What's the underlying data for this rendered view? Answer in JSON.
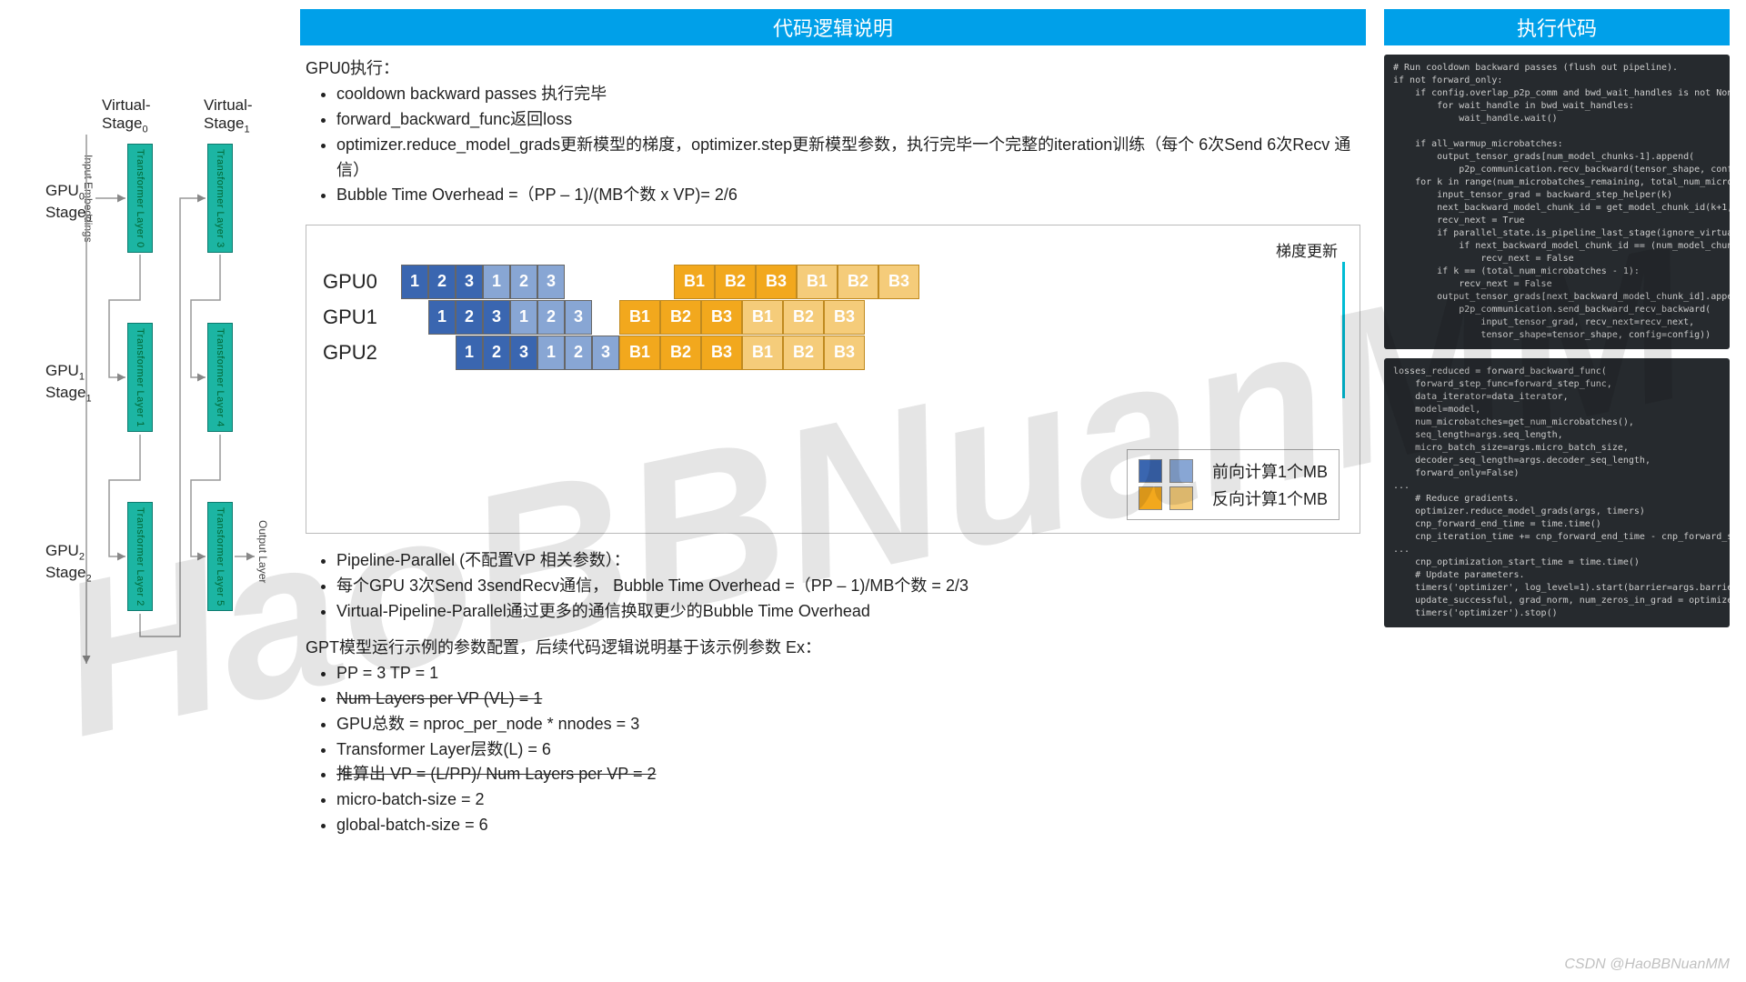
{
  "watermark": "HaoBBNuanMM",
  "footer": "CSDN @HaoBBNuanMM",
  "headers": {
    "mid": "代码逻辑说明",
    "right": "执行代码"
  },
  "left_diagram": {
    "vs0": "Virtual-Stage",
    "vs0_sub": "0",
    "vs1": "Virtual-Stage",
    "vs1_sub": "1",
    "gpu0_a": "GPU",
    "gpu0_as": "0",
    "gpu0_b": "Stage",
    "gpu0_bs": "0",
    "gpu1_a": "GPU",
    "gpu1_as": "1",
    "gpu1_b": "Stage",
    "gpu1_bs": "1",
    "gpu2_a": "GPU",
    "gpu2_as": "2",
    "gpu2_b": "Stage",
    "gpu2_bs": "2",
    "tl0": "Transformer Layer 0",
    "tl1": "Transformer Layer 1",
    "tl2": "Transformer Layer 2",
    "tl3": "Transformer Layer 3",
    "tl4": "Transformer Layer 4",
    "tl5": "Transformer Layer 5",
    "inp": "Input Embeddings",
    "out": "Output Layer"
  },
  "section1": {
    "title": "GPU0执行：",
    "b1": "cooldown backward passes 执行完毕",
    "b2": "forward_backward_func返回loss",
    "b3": "optimizer.reduce_model_grads更新模型的梯度，optimizer.step更新模型参数，执行完毕一个完整的iteration训练（每个 6次Send 6次Recv 通信）",
    "b4": "Bubble Time Overhead =（PP – 1)/(MB个数 x VP)= 2/6"
  },
  "sched": {
    "grad": "梯度更新",
    "gpu0": "GPU0",
    "gpu1": "GPU1",
    "gpu2": "GPU2",
    "n1": "1",
    "n2": "2",
    "n3": "3",
    "B1": "B1",
    "B2": "B2",
    "B3": "B3",
    "leg_fwd": "前向计算1个MB",
    "leg_bwd": "反向计算1个MB"
  },
  "section2": {
    "b1": "Pipeline-Parallel (不配置VP 相关参数）：",
    "b2": "每个GPU 3次Send 3sendRecv通信， Bubble Time Overhead =（PP – 1)/MB个数 = 2/3",
    "b3": "Virtual-Pipeline-Parallel通过更多的通信换取更少的Bubble Time Overhead"
  },
  "section3": {
    "title": "GPT模型运行示例的参数配置，后续代码逻辑说明基于该示例参数 Ex：",
    "b1": "PP = 3 TP = 1",
    "b2": "Num Layers per VP (VL) = 1",
    "b3": "GPU总数 = nproc_per_node * nnodes = 3",
    "b4": "Transformer Layer层数(L) = 6",
    "b5": "推算出 VP = (L/PP)/ Num Layers per VP = 2",
    "b6": "micro-batch-size = 2",
    "b7": "global-batch-size = 6"
  },
  "code1": "# Run cooldown backward passes (flush out pipeline).\nif not forward_only:\n    if config.overlap_p2p_comm and bwd_wait_handles is not None:\n        for wait_handle in bwd_wait_handles:\n            wait_handle.wait()\n\n    if all_warmup_microbatches:\n        output_tensor_grads[num_model_chunks-1].append(\n            p2p_communication.recv_backward(tensor_shape, config=config))\n    for k in range(num_microbatches_remaining, total_num_microbatches):\n        input_tensor_grad = backward_step_helper(k)\n        next_backward_model_chunk_id = get_model_chunk_id(k+1, forward=False)\n        recv_next = True\n        if parallel_state.is_pipeline_last_stage(ignore_virtual=True):\n            if next_backward_model_chunk_id == (num_model_chunks - 1):\n                recv_next = False\n        if k == (total_num_microbatches - 1):\n            recv_next = False\n        output_tensor_grads[next_backward_model_chunk_id].append(\n            p2p_communication.send_backward_recv_backward(\n                input_tensor_grad, recv_next=recv_next,\n                tensor_shape=tensor_shape, config=config))",
  "code2": "losses_reduced = forward_backward_func(\n    forward_step_func=forward_step_func,\n    data_iterator=data_iterator,\n    model=model,\n    num_microbatches=get_num_microbatches(),\n    seq_length=args.seq_length,\n    micro_batch_size=args.micro_batch_size,\n    decoder_seq_length=args.decoder_seq_length,\n    forward_only=False)\n...\n    # Reduce gradients.\n    optimizer.reduce_model_grads(args, timers)\n    cnp_forward_end_time = time.time()\n    cnp_iteration_time += cnp_forward_end_time - cnp_forward_start_time\n...\n    cnp_optimization_start_time = time.time()\n    # Update parameters.\n    timers('optimizer', log_level=1).start(barrier=args.barrier_with_L1_time)\n    update_successful, grad_norm, num_zeros_in_grad = optimizer.step(args, timers)\n    timers('optimizer').stop()"
}
